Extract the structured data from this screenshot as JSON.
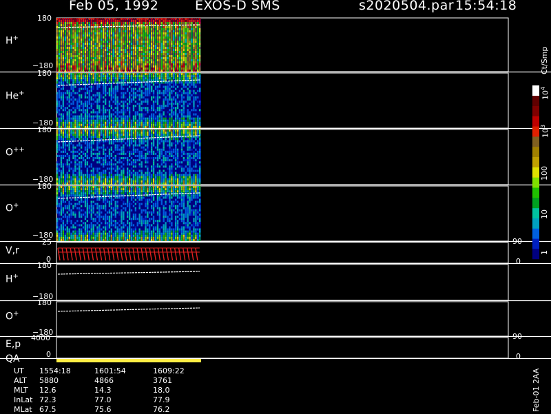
{
  "header": {
    "date": "Feb 05, 1992",
    "instrument": "EXOS-D SMS",
    "file": "s2020504.par",
    "time": "15:54:18"
  },
  "panels": [
    {
      "label": "H",
      "sup": "+",
      "ymax": "180",
      "ymin": "−180"
    },
    {
      "label": "He",
      "sup": "+",
      "ymax": "180",
      "ymin": "−180"
    },
    {
      "label": "O",
      "sup": "++",
      "ymax": "180",
      "ymin": "−180"
    },
    {
      "label": "O",
      "sup": "+",
      "ymax": "180",
      "ymin": "−180"
    }
  ],
  "vr_panel": {
    "label": "V,r",
    "left_top": "25",
    "left_bottom": "0",
    "right_top": "90",
    "right_bottom": "0",
    "color": "#e02020"
  },
  "h_angle_panel": {
    "label": "H",
    "sup": "+",
    "ymax": "180",
    "ymin": "−180"
  },
  "o_angle_panel": {
    "label": "O",
    "sup": "+",
    "ymax": "180",
    "ymin": "−180"
  },
  "ep_panel": {
    "label": "E,p",
    "left_top": "4000",
    "left_bottom": "0",
    "right_top": "90",
    "right_bottom": "0"
  },
  "qa_panel": {
    "label": "QA",
    "color": "#ffee44"
  },
  "colorbar": {
    "unit": "Ct/Smp",
    "ticks": [
      {
        "text": "1",
        "value": 1
      },
      {
        "text": "10",
        "value": 10
      },
      {
        "text": "100",
        "value": 100
      },
      {
        "text": "10",
        "sup": "3",
        "value": 1000
      },
      {
        "text": "10",
        "sup": "4",
        "value": 10000
      }
    ],
    "colors": [
      "#000080",
      "#0020c0",
      "#0060e0",
      "#00a0c0",
      "#00c0a0",
      "#00a020",
      "#20c000",
      "#80e000",
      "#e0e000",
      "#c0a000",
      "#a08000",
      "#806020",
      "#e02000",
      "#c00000",
      "#800000",
      "#600000",
      "#ffffff"
    ]
  },
  "footer": {
    "rows": [
      {
        "name": "UT",
        "values": [
          "1554:18",
          "1601:54",
          "1609:22"
        ]
      },
      {
        "name": "ALT",
        "values": [
          "5880",
          "4866",
          "3761"
        ]
      },
      {
        "name": "MLT",
        "values": [
          "12.6",
          "14.3",
          "18.0"
        ]
      },
      {
        "name": "InLat",
        "values": [
          "72.3",
          "77.0",
          "77.9"
        ]
      },
      {
        "name": "MLat",
        "values": [
          "67.5",
          "75.6",
          "76.2"
        ]
      }
    ],
    "stamp": "Feb-01 2AA"
  },
  "chart_data": {
    "type": "heatmap",
    "title": "Feb 05, 1992   EXOS-D SMS",
    "x": [
      "1554:18",
      "1601:54",
      "1609:22"
    ],
    "xlabel": "UT",
    "ylim": [
      -180,
      180
    ],
    "data_extent_fraction": 0.32,
    "series": [
      {
        "name": "H+"
      },
      {
        "name": "He+"
      },
      {
        "name": "O++"
      },
      {
        "name": "O+"
      }
    ],
    "colorbar_range": [
      1,
      10000
    ],
    "colorbar_scale": "log",
    "grid": false
  }
}
